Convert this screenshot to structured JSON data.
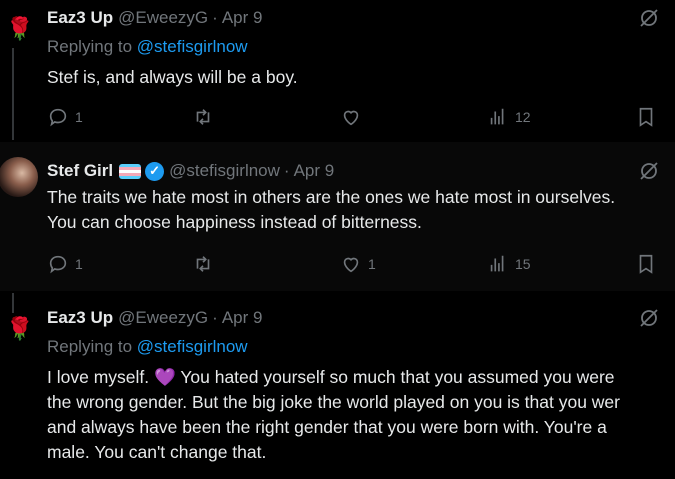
{
  "tweets": [
    {
      "author_name": "Eaz3 Up",
      "author_handle": "@EweezyG",
      "separator": "·",
      "date": "Apr 9",
      "replying_prefix": "Replying to",
      "replying_handle": "@stefisgirlnow",
      "text_lines": [
        "Stef is, and always will be a boy."
      ],
      "reply_count": "1",
      "retweet_count": "",
      "like_count": "",
      "view_count": "12",
      "avatar_icon": "rose-icon"
    },
    {
      "author_name": "Stef Girl",
      "author_handle": "@stefisgirlnow",
      "separator": "·",
      "date": "Apr 9",
      "text_lines": [
        "The traits we hate most in others are the ones we hate most in ourselves.",
        "You can choose happiness instead of bitterness."
      ],
      "reply_count": "1",
      "retweet_count": "",
      "like_count": "1",
      "view_count": "15",
      "avatar_icon": "profile-photo"
    },
    {
      "author_name": "Eaz3 Up",
      "author_handle": "@EweezyG",
      "separator": "·",
      "date": "Apr 9",
      "replying_prefix": "Replying to",
      "replying_handle": "@stefisgirlnow",
      "text_lines": [
        "I love myself. ",
        "You hated yourself so much that you assumed you were",
        "the wrong gender. But the big joke the world played on you is that you wer",
        "and always have been the right gender that you were born with. You're a",
        "male. You can't change that."
      ],
      "emoji": "💜",
      "avatar_icon": "rose-icon"
    }
  ],
  "colors": {
    "background": "#000000",
    "text": "#e7e9ea",
    "muted": "#71767b",
    "link": "#1d9bf0"
  }
}
